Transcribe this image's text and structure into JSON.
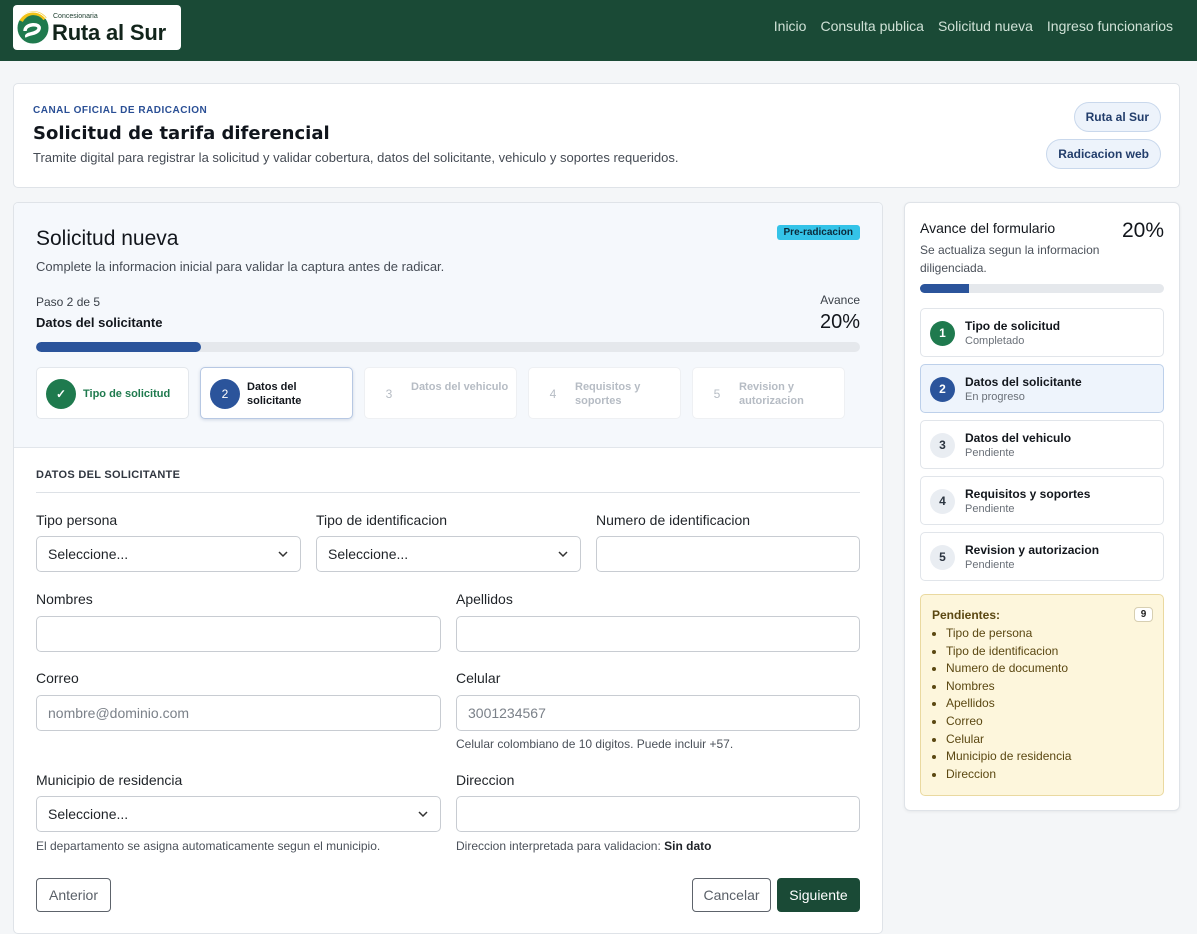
{
  "nav": {
    "logo_small": "Concesionaria",
    "logo_big": "Ruta al Sur",
    "links": [
      "Inicio",
      "Consulta publica",
      "Solicitud nueva",
      "Ingreso funcionarios"
    ]
  },
  "header": {
    "eyebrow": "CANAL OFICIAL DE RADICACION",
    "title": "Solicitud de tarifa diferencial",
    "description": "Tramite digital para registrar la solicitud y validar cobertura, datos del solicitante, vehiculo y soportes requeridos.",
    "pill_1": "Ruta al Sur",
    "pill_2": "Radicacion web"
  },
  "form": {
    "title": "Solicitud nueva",
    "description": "Complete la informacion inicial para validar la captura antes de radicar.",
    "badge": "Pre-radicacion",
    "step_of": "Paso 2 de 5",
    "step_name": "Datos del solicitante",
    "avance_label": "Avance",
    "avance_value": "20%",
    "progress_fraction": 0.2,
    "steps": [
      {
        "num": "✓",
        "label": "Tipo de solicitud",
        "state": "done"
      },
      {
        "num": "2",
        "label": "Datos del solicitante",
        "state": "active"
      },
      {
        "num": "3",
        "label": "Datos del vehiculo",
        "state": "pending"
      },
      {
        "num": "4",
        "label": "Requisitos y soportes",
        "state": "pending"
      },
      {
        "num": "5",
        "label": "Revision y autorizacion",
        "state": "pending"
      }
    ],
    "section_title": "DATOS DEL SOLICITANTE",
    "fields": {
      "tipo_persona": {
        "label": "Tipo persona",
        "value": "Seleccione..."
      },
      "tipo_id": {
        "label": "Tipo de identificacion",
        "value": "Seleccione..."
      },
      "num_id": {
        "label": "Numero de identificacion",
        "value": ""
      },
      "nombres": {
        "label": "Nombres",
        "value": ""
      },
      "apellidos": {
        "label": "Apellidos",
        "value": ""
      },
      "correo": {
        "label": "Correo",
        "placeholder": "nombre@dominio.com"
      },
      "celular": {
        "label": "Celular",
        "placeholder": "3001234567",
        "help": "Celular colombiano de 10 digitos. Puede incluir +57."
      },
      "municipio": {
        "label": "Municipio de residencia",
        "value": "Seleccione...",
        "help": "El departamento se asigna automaticamente segun el municipio."
      },
      "direccion": {
        "label": "Direccion",
        "value": "",
        "help_prefix": "Direccion interpretada para validacion:",
        "help_value": "Sin dato"
      }
    },
    "buttons": {
      "previous": "Anterior",
      "cancel": "Cancelar",
      "next": "Siguiente"
    }
  },
  "sidebar": {
    "title": "Avance del formulario",
    "percent": "20%",
    "progress_fraction": 0.2,
    "description": "Se actualiza segun la informacion diligenciada.",
    "items": [
      {
        "num": "1",
        "title": "Tipo de solicitud",
        "status": "Completado",
        "state": "done"
      },
      {
        "num": "2",
        "title": "Datos del solicitante",
        "status": "En progreso",
        "state": "active"
      },
      {
        "num": "3",
        "title": "Datos del vehiculo",
        "status": "Pendiente",
        "state": "pending"
      },
      {
        "num": "4",
        "title": "Requisitos y soportes",
        "status": "Pendiente",
        "state": "pending"
      },
      {
        "num": "5",
        "title": "Revision y autorizacion",
        "status": "Pendiente",
        "state": "pending"
      }
    ],
    "pending_title": "Pendientes:",
    "pending_count": "9",
    "pending_items": [
      "Tipo de persona",
      "Tipo de identificacion",
      "Numero de documento",
      "Nombres",
      "Apellidos",
      "Correo",
      "Celular",
      "Municipio de residencia",
      "Direccion"
    ]
  },
  "colors": {
    "nav_bg": "#1a4a36",
    "accent_blue": "#2b549b",
    "success_green": "#1f7a4e",
    "badge_cyan": "#34c3e8",
    "pending_bg": "#fdf6dc"
  }
}
